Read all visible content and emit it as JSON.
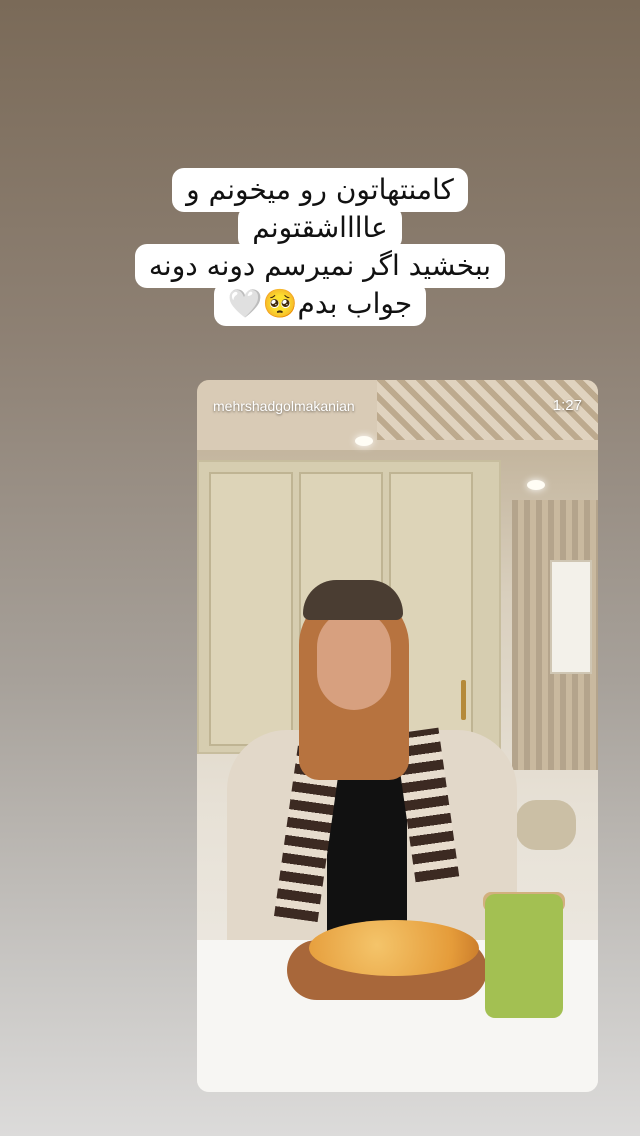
{
  "caption": {
    "lines": [
      "کامنتهاتون رو میخونم و",
      "عااااشقتونم",
      "ببخشید اگر نمیرسم دونه دونه",
      "جواب بدم🥺🤍"
    ]
  },
  "shared_post": {
    "username": "mehrshadgolmakanian",
    "duration": "1:27"
  }
}
